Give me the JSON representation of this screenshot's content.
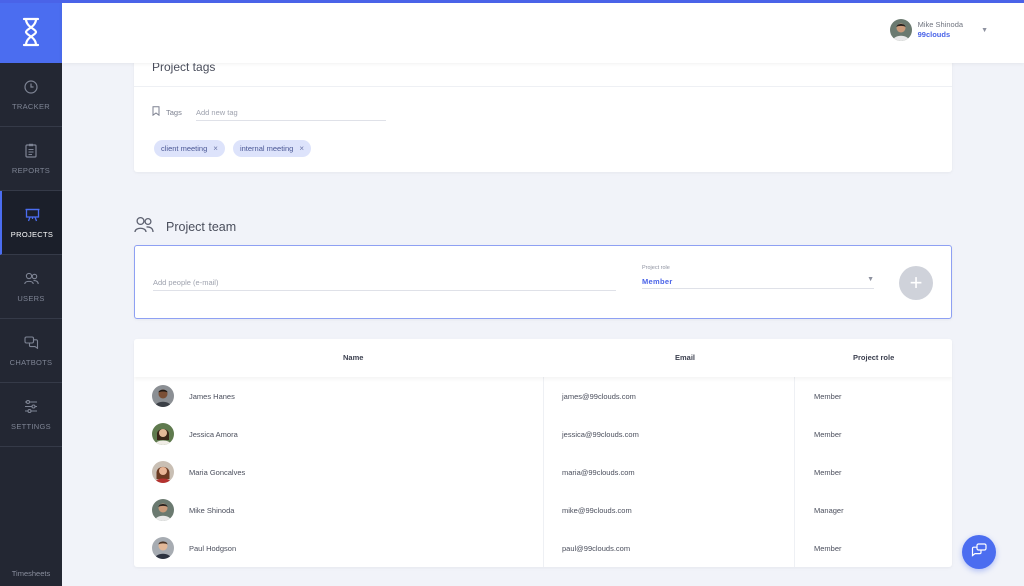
{
  "sidebar": {
    "items": [
      {
        "label": "TRACKER",
        "icon": "clock-icon",
        "active": false
      },
      {
        "label": "REPORTS",
        "icon": "clipboard-icon",
        "active": false
      },
      {
        "label": "PROJECTS",
        "icon": "presentation-board-icon",
        "active": true
      },
      {
        "label": "USERS",
        "icon": "users-icon",
        "active": false
      },
      {
        "label": "CHATBOTS",
        "icon": "chat-bubbles-icon",
        "active": false
      },
      {
        "label": "SETTINGS",
        "icon": "sliders-icon",
        "active": false
      }
    ],
    "footer": "Timesheets"
  },
  "header": {
    "user_name": "Mike Shinoda",
    "company": "99clouds"
  },
  "tags": {
    "title": "Project tags",
    "label": "Tags",
    "input_placeholder": "Add new tag",
    "chips": [
      "client meeting",
      "internal meeting"
    ]
  },
  "team": {
    "title": "Project team",
    "people_placeholder": "Add people (e-mail)",
    "role_label": "Project role",
    "role_value": "Member",
    "add_button": "+"
  },
  "table": {
    "columns": [
      "Name",
      "Email",
      "Project role"
    ],
    "rows": [
      {
        "name": "James Hanes",
        "email": "james@99clouds.com",
        "role": "Member"
      },
      {
        "name": "Jessica Amora",
        "email": "jessica@99clouds.com",
        "role": "Member"
      },
      {
        "name": "Maria Goncalves",
        "email": "maria@99clouds.com",
        "role": "Member"
      },
      {
        "name": "Mike Shinoda",
        "email": "mike@99clouds.com",
        "role": "Manager"
      },
      {
        "name": "Paul Hodgson",
        "email": "paul@99clouds.com",
        "role": "Member"
      }
    ]
  },
  "colors": {
    "accent": "#4b6df0",
    "sidebar": "#232733",
    "chip": "#dde3fb"
  }
}
